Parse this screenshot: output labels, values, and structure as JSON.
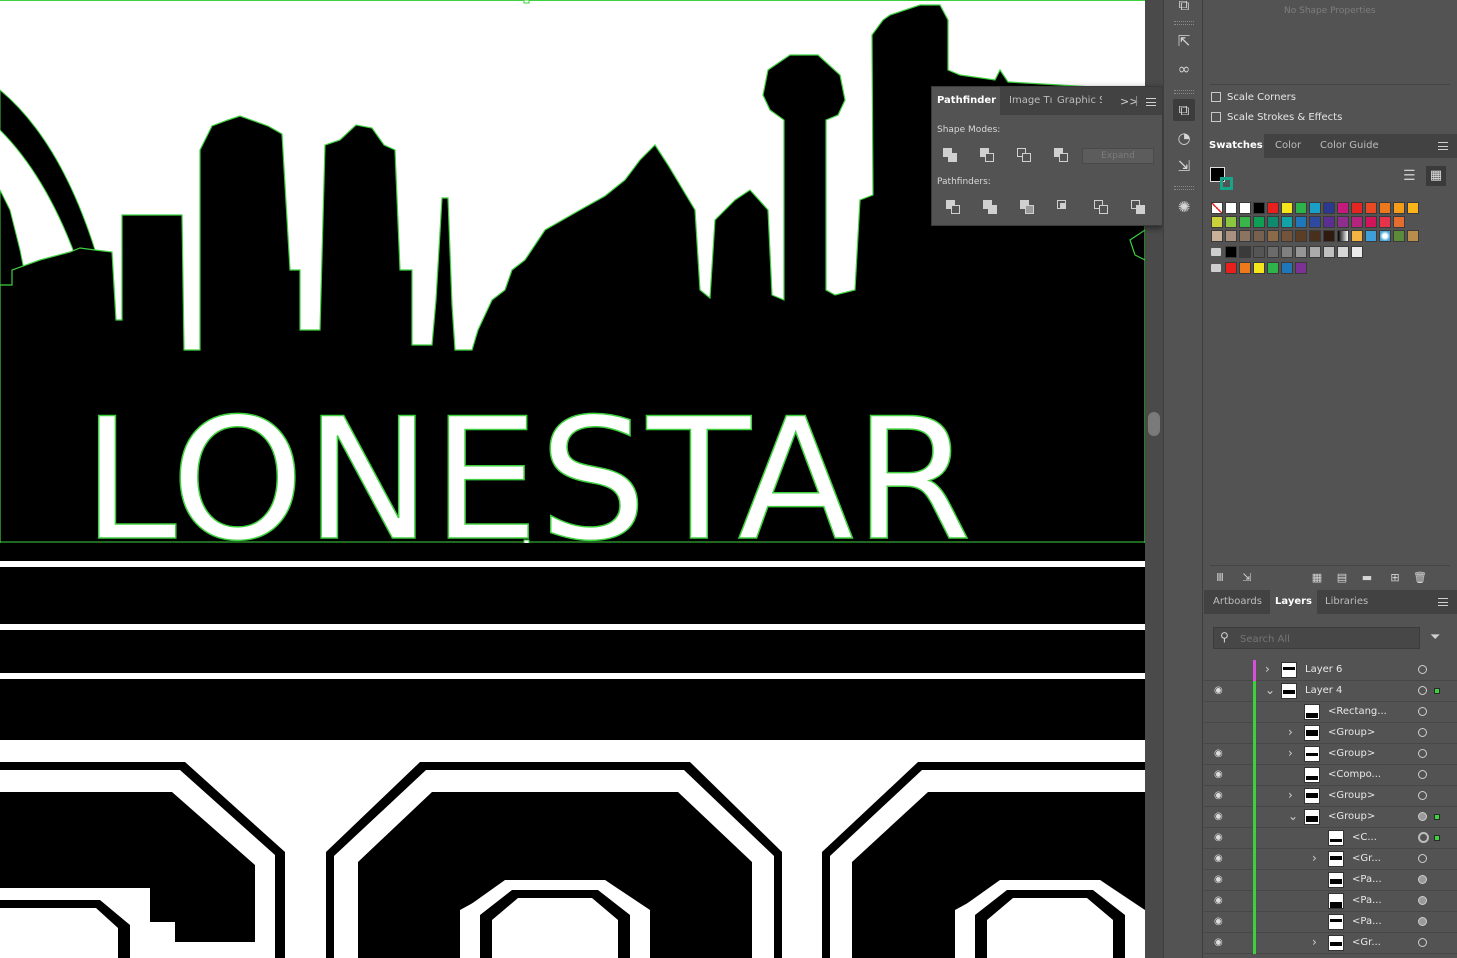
{
  "canvas": {
    "logo_text": "LONESTAR"
  },
  "pathfinder": {
    "tabs": [
      "Pathfinder",
      "Image Tı",
      "Graphic S"
    ],
    "overflow_label": ">>",
    "shape_modes_label": "Shape Modes:",
    "pathfinders_label": "Pathfinders:",
    "expand_label": "Expand"
  },
  "properties": {
    "no_shape": "No Shape Properties",
    "scale_corners": "Scale Corners",
    "scale_strokes": "Scale Strokes & Effects"
  },
  "swatches_panel": {
    "tabs": [
      "Swatches",
      "Color",
      "Color Guide"
    ],
    "active_tab": "Swatches"
  },
  "layers_panel": {
    "tabs": [
      "Artboards",
      "Layers",
      "Libraries"
    ],
    "active_tab": "Layers",
    "search_placeholder": "Search All",
    "rows": [
      {
        "name": "Layer 6",
        "eye": false,
        "indent": 0,
        "twirl": ">",
        "color": "#d84fd8"
      },
      {
        "name": "Layer 4",
        "eye": true,
        "indent": 0,
        "twirl": "v",
        "color": "#3ed13e"
      },
      {
        "name": "<Rectang...",
        "eye": false,
        "indent": 1,
        "twirl": "",
        "color": "#3ed13e"
      },
      {
        "name": "<Group>",
        "eye": false,
        "indent": 1,
        "twirl": ">",
        "color": "#3ed13e"
      },
      {
        "name": "<Group>",
        "eye": true,
        "indent": 1,
        "twirl": ">",
        "color": "#3ed13e"
      },
      {
        "name": "<Compo...",
        "eye": true,
        "indent": 1,
        "twirl": "",
        "color": "#3ed13e"
      },
      {
        "name": "<Group>",
        "eye": true,
        "indent": 1,
        "twirl": ">",
        "color": "#3ed13e"
      },
      {
        "name": "<Group>",
        "eye": true,
        "indent": 1,
        "twirl": "v",
        "color": "#3ed13e"
      },
      {
        "name": "<C...",
        "eye": true,
        "indent": 2,
        "twirl": "",
        "color": "#3ed13e"
      },
      {
        "name": "<Gr...",
        "eye": true,
        "indent": 2,
        "twirl": ">",
        "color": "#3ed13e"
      },
      {
        "name": "<Pa...",
        "eye": true,
        "indent": 2,
        "twirl": "",
        "color": "#3ed13e"
      },
      {
        "name": "<Pa...",
        "eye": true,
        "indent": 2,
        "twirl": "",
        "color": "#3ed13e"
      },
      {
        "name": "<Pa...",
        "eye": true,
        "indent": 2,
        "twirl": "",
        "color": "#3ed13e"
      },
      {
        "name": "<Gr...",
        "eye": true,
        "indent": 2,
        "twirl": ">",
        "color": "#3ed13e"
      }
    ]
  },
  "colors": {
    "selection": "#3ed13e",
    "panel_bg": "#535353",
    "tab_bg": "#424242"
  }
}
